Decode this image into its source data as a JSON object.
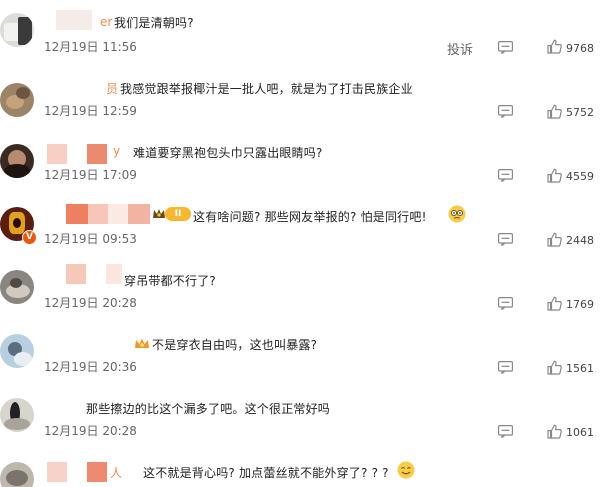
{
  "actions": {
    "report_label": "投诉"
  },
  "comments": [
    {
      "name_tail": "er",
      "text": "我们是清朝吗?",
      "date": "12月19日 11:56",
      "likes": "9768",
      "show_report": true
    },
    {
      "name_tail": "员",
      "text": "我感觉跟举报椰汁是一批人吧，就是为了打击民族企业",
      "date": "12月19日 12:59",
      "likes": "5752"
    },
    {
      "name_tail": "y",
      "text": "难道要穿黑袍包头巾只露出眼睛吗?",
      "date": "12月19日 17:09",
      "likes": "4559"
    },
    {
      "name_tail": "",
      "medal_level": "II",
      "text": "这有啥问题? 那些网友举报的? 怕是同行吧!",
      "date": "12月19日 09:53",
      "likes": "2448",
      "verified_badge": "V"
    },
    {
      "name_tail": "",
      "text": "穿吊带都不行了?",
      "date": "12月19日 20:28",
      "likes": "1769"
    },
    {
      "name_tail": "",
      "text": "不是穿衣自由吗，这也叫暴露?",
      "date": "12月19日 20:36",
      "likes": "1561"
    },
    {
      "name_tail": "",
      "text": "那些擦边的比这个漏多了吧。这个很正常好吗",
      "date": "12月19日 20:28",
      "likes": "1061"
    },
    {
      "name_tail": "人",
      "text": "这不就是背心吗? 加点蕾丝就不能外穿了? ? ?",
      "date": "",
      "likes": ""
    }
  ],
  "colors": {
    "like": "#888888",
    "date": "#666666",
    "name_tail": "#f08a50",
    "verified": "#e8590c"
  },
  "icons": {
    "reply": "comment-bubble-icon",
    "like": "thumbs-up-icon"
  }
}
